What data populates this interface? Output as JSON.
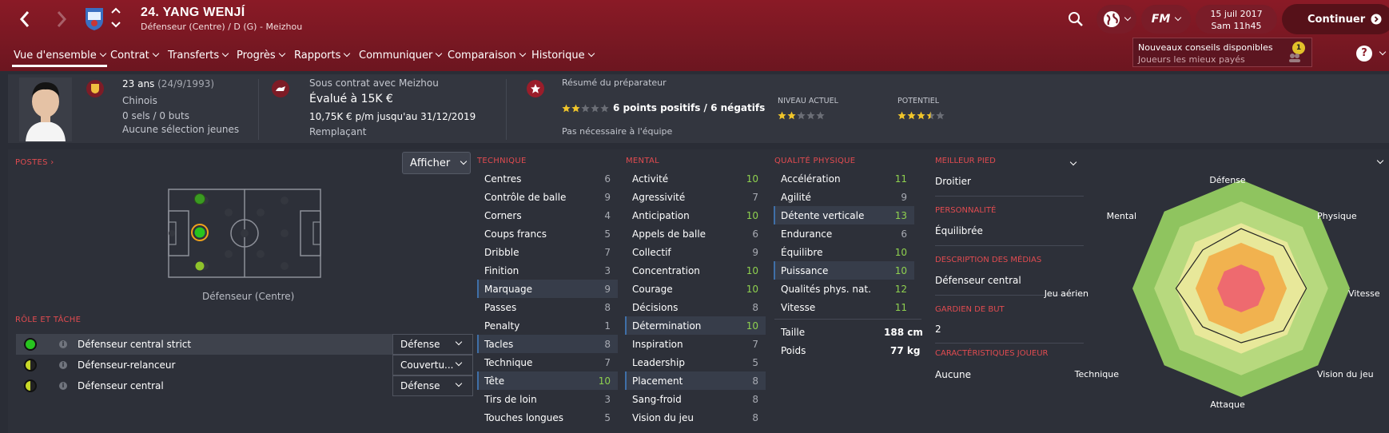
{
  "header": {
    "player_title": "24. YANG WENJÍ",
    "player_subtitle": "Défenseur (Centre) / D (G) - Meizhou",
    "date_line1": "15 juil 2017",
    "date_line2": "Sam 11h45",
    "continue_label": "Continuer",
    "logo_text": "FM"
  },
  "menu": [
    "Vue d'ensemble",
    "Contrat",
    "Transferts",
    "Progrès",
    "Rapports",
    "Communiquer",
    "Comparaison",
    "Historique"
  ],
  "tip": {
    "title": "Nouveaux conseils disponibles",
    "subtitle": "Joueurs les mieux payés",
    "count": "1"
  },
  "help": "?",
  "overview": {
    "age": "23 ans",
    "birth": "(24/9/1993)",
    "nationality": "Chinois",
    "caps": "0 sels / 0 buts",
    "youth": "Aucune sélection jeunes",
    "contract_with": "Sous contrat avec Meizhou",
    "value": "Évalué à 15K €",
    "wage": "10,75K € p/m jusqu'au 31/12/2019",
    "status": "Remplaçant",
    "coach_summary": "Résumé du préparateur",
    "points": "6 points positifs / 6 négatifs",
    "coach_stars": 2,
    "need": "Pas nécessaire à l'équipe",
    "current_label": "NIVEAU ACTUEL",
    "current_stars": 2,
    "potential_label": "POTENTIEL",
    "potential_stars": 3.5
  },
  "positions": {
    "label": "POSTES",
    "dropdown": "Afficher",
    "caption": "Défenseur (Centre)"
  },
  "roles": {
    "label": "RÔLE ET TÂCHE",
    "items": [
      {
        "name": "Défenseur central strict",
        "duty": "Défense",
        "color": "#27c41f"
      },
      {
        "name": "Défenseur-relanceur",
        "duty": "Couvertu...",
        "color": "#c7d829"
      },
      {
        "name": "Défenseur central",
        "duty": "Défense",
        "color": "#c7d829"
      }
    ]
  },
  "technique": {
    "label": "TECHNIQUE",
    "items": [
      [
        "Centres",
        "6"
      ],
      [
        "Contrôle de balle",
        "9"
      ],
      [
        "Corners",
        "4"
      ],
      [
        "Coups francs",
        "5"
      ],
      [
        "Dribble",
        "7"
      ],
      [
        "Finition",
        "3"
      ],
      [
        "Marquage",
        "9"
      ],
      [
        "Passes",
        "8"
      ],
      [
        "Penalty",
        "1"
      ],
      [
        "Tacles",
        "8"
      ],
      [
        "Technique",
        "7"
      ],
      [
        "Tête",
        "10"
      ],
      [
        "Tirs de loin",
        "3"
      ],
      [
        "Touches longues",
        "5"
      ]
    ]
  },
  "mental": {
    "label": "MENTAL",
    "items": [
      [
        "Activité",
        "10"
      ],
      [
        "Agressivité",
        "7"
      ],
      [
        "Anticipation",
        "10"
      ],
      [
        "Appels de balle",
        "6"
      ],
      [
        "Collectif",
        "9"
      ],
      [
        "Concentration",
        "10"
      ],
      [
        "Courage",
        "10"
      ],
      [
        "Décisions",
        "8"
      ],
      [
        "Détermination",
        "10"
      ],
      [
        "Inspiration",
        "7"
      ],
      [
        "Leadership",
        "5"
      ],
      [
        "Placement",
        "8"
      ],
      [
        "Sang-froid",
        "8"
      ],
      [
        "Vision du jeu",
        "8"
      ]
    ]
  },
  "physical": {
    "label": "QUALITÉ PHYSIQUE",
    "items": [
      [
        "Accélération",
        "11"
      ],
      [
        "Agilité",
        "9"
      ],
      [
        "Détente verticale",
        "13"
      ],
      [
        "Endurance",
        "6"
      ],
      [
        "Équilibre",
        "10"
      ],
      [
        "Puissance",
        "10"
      ],
      [
        "Qualités phys. nat.",
        "12"
      ],
      [
        "Vitesse",
        "11"
      ]
    ],
    "height_label": "Taille",
    "height": "188 cm",
    "weight_label": "Poids",
    "weight": "77 kg"
  },
  "info": {
    "foot_label": "MEILLEUR PIED",
    "foot": "Droitier",
    "pers_label": "PERSONNALITÉ",
    "pers": "Équilibrée",
    "media_label": "DESCRIPTION DES MÉDIAS",
    "media": "Défenseur central",
    "gk_label": "GARDIEN DE BUT",
    "gk": "2",
    "traits_label": "CARACTÉRISTIQUES JOUEUR",
    "traits": "Aucune"
  },
  "radar": {
    "axes": [
      "Défense",
      "Physique",
      "Vitesse",
      "Vision du jeu",
      "Attaque",
      "Technique",
      "Jeu aérien",
      "Mental"
    ],
    "values": [
      0.55,
      0.55,
      0.6,
      0.55,
      0.5,
      0.5,
      0.6,
      0.5
    ]
  },
  "colors": {
    "accent": "#e14b50",
    "header": "#8a1a26",
    "green": "#8fd14f"
  }
}
